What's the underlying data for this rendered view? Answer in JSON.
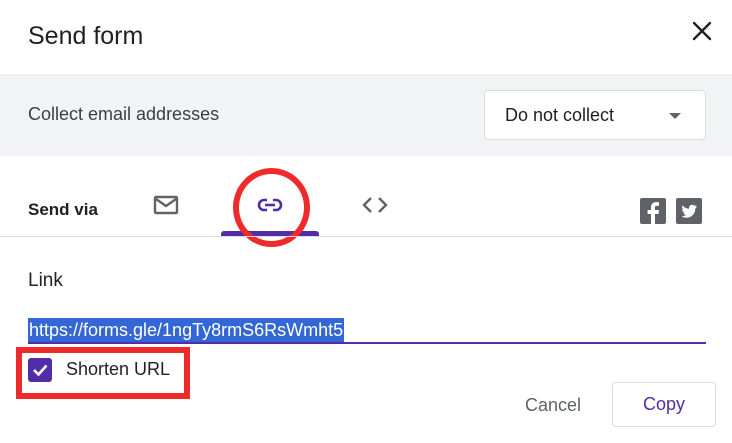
{
  "dialog": {
    "title": "Send form"
  },
  "collect": {
    "label": "Collect email addresses",
    "selected": "Do not collect"
  },
  "send_via": {
    "label": "Send via",
    "tabs": [
      {
        "name": "email",
        "icon": "mail-icon",
        "active": false
      },
      {
        "name": "link",
        "icon": "link-icon",
        "active": true
      },
      {
        "name": "embed",
        "icon": "code-icon",
        "active": false
      }
    ],
    "social": [
      "facebook-icon",
      "twitter-icon"
    ]
  },
  "link": {
    "heading": "Link",
    "url": "https://forms.gle/1ngTy8rmS6RsWmht5",
    "shorten_label": "Shorten URL",
    "shorten_checked": true
  },
  "actions": {
    "cancel": "Cancel",
    "copy": "Copy"
  },
  "colors": {
    "accent": "#512da8",
    "annotation": "#ef2a2a",
    "selection": "#3367d6"
  }
}
